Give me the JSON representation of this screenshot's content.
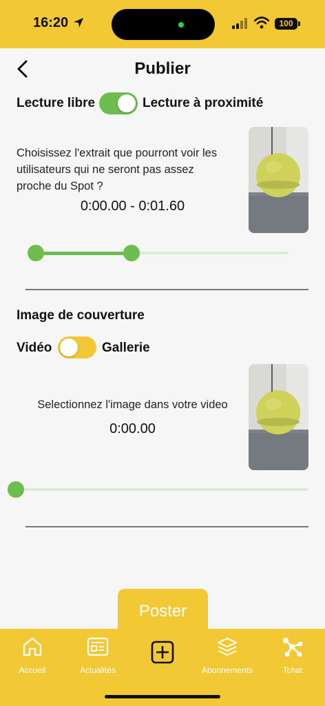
{
  "status_bar": {
    "time": "16:20",
    "battery": "100"
  },
  "header": {
    "title": "Publier"
  },
  "reading_toggle": {
    "left_label": "Lecture libre",
    "right_label": "Lecture à proximité"
  },
  "excerpt": {
    "instruction_lines": [
      "Choisissez l'extrait que pourront voir les",
      "utilisateurs qui ne seront pas assez",
      "proche du Spot ?"
    ],
    "time_range": "0:00.00 - 0:01.60",
    "range_start_fraction": 0.0,
    "range_end_fraction": 0.38
  },
  "cover": {
    "section_title": "Image de couverture",
    "left_label": "Vidéo",
    "right_label": "Gallerie",
    "instruction": "Selectionnez l'image dans votre video",
    "time": "0:00.00",
    "position_fraction": 0.0
  },
  "post_button": {
    "label": "Poster"
  },
  "tab_bar": {
    "items": [
      {
        "label": "Accueil",
        "icon": "home-icon"
      },
      {
        "label": "Actualités",
        "icon": "news-icon"
      },
      {
        "label": "",
        "icon": "add-icon"
      },
      {
        "label": "Abonnements",
        "icon": "layers-icon"
      },
      {
        "label": "Tchat",
        "icon": "network-icon"
      }
    ]
  },
  "colors": {
    "accent_yellow": "#f2c935",
    "accent_green": "#6dbe4f"
  }
}
